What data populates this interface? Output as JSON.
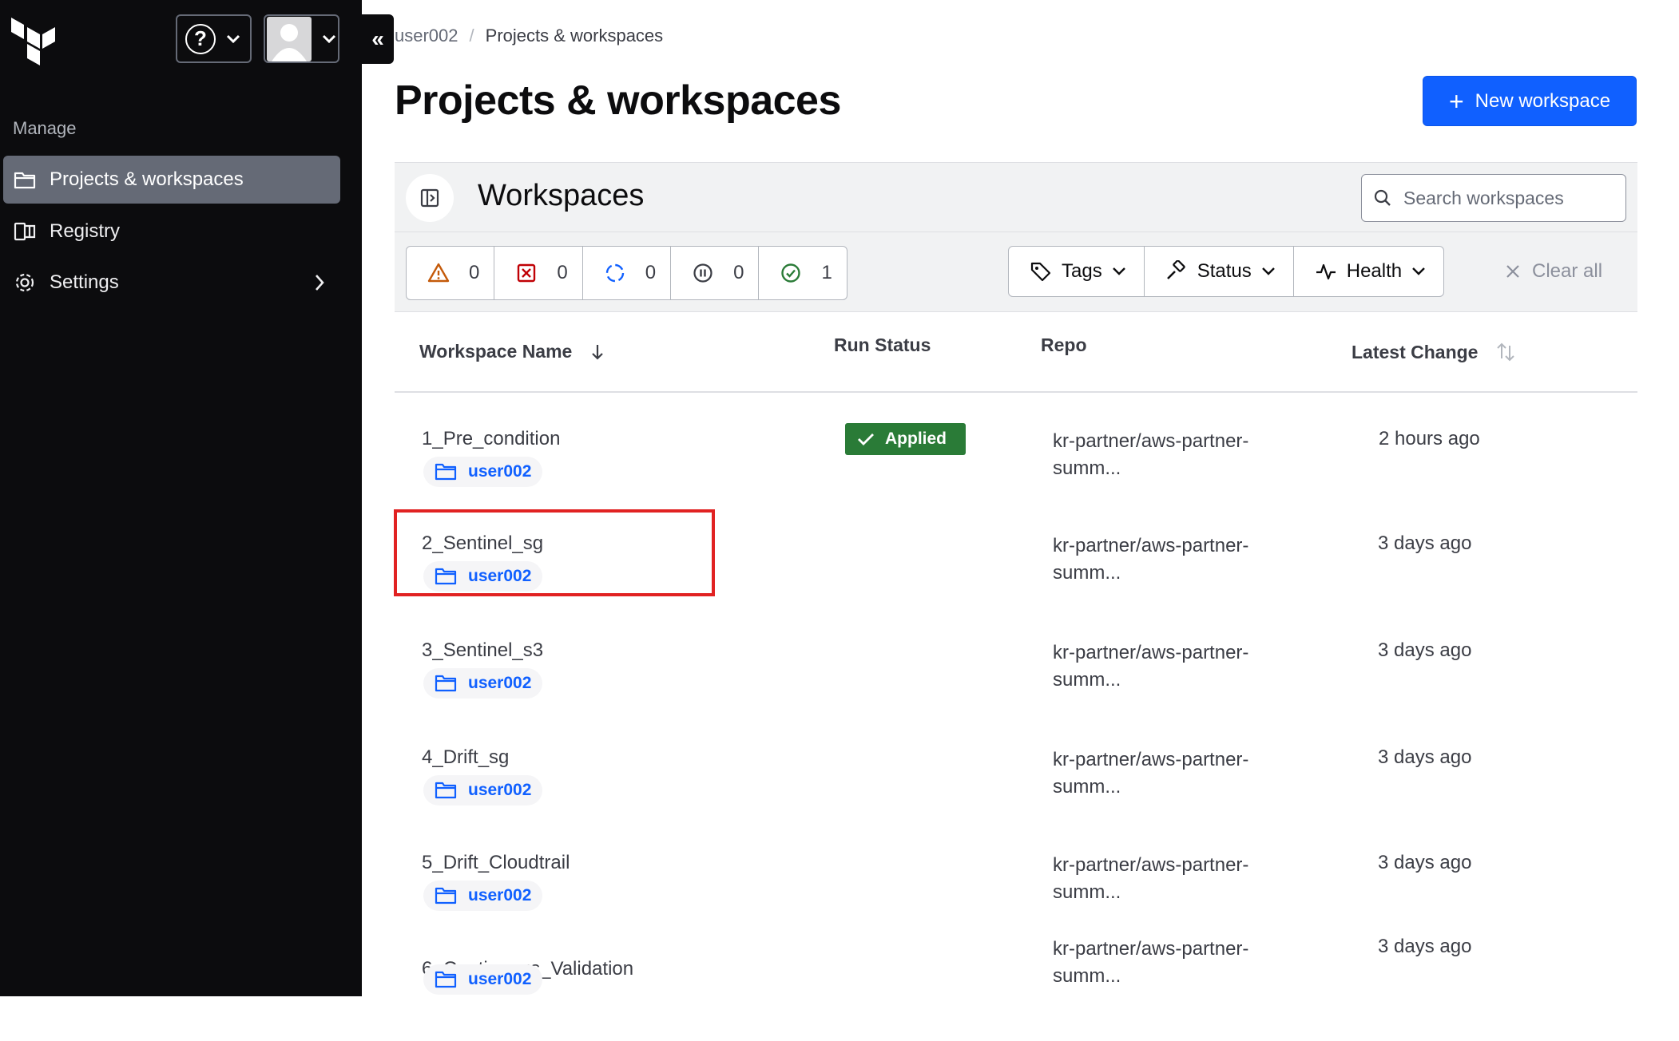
{
  "sidebar": {
    "section_label": "Manage",
    "items": [
      {
        "label": "Projects & workspaces",
        "icon": "folder-icon",
        "active": true
      },
      {
        "label": "Registry",
        "icon": "registry-icon",
        "active": false
      },
      {
        "label": "Settings",
        "icon": "gear-icon",
        "active": false
      }
    ],
    "collapse_glyph": "«",
    "help_glyph": "?"
  },
  "breadcrumb": {
    "parent": "user002",
    "separator": "/",
    "current": "Projects & workspaces"
  },
  "page": {
    "title": "Projects & workspaces",
    "new_workspace_label": "New workspace",
    "new_workspace_plus": "+"
  },
  "workspaces_panel": {
    "title": "Workspaces",
    "search_placeholder": "Search workspaces"
  },
  "status_counts": [
    {
      "icon": "warning-icon",
      "count": "0",
      "color": "#c45a0a"
    },
    {
      "icon": "error-icon",
      "count": "0",
      "color": "#c00005"
    },
    {
      "icon": "running-icon",
      "count": "0",
      "color": "#1060ff"
    },
    {
      "icon": "paused-icon",
      "count": "0",
      "color": "#3b3d45"
    },
    {
      "icon": "success-icon",
      "count": "1",
      "color": "#2a7b37"
    }
  ],
  "filters": {
    "tags": "Tags",
    "status": "Status",
    "health": "Health",
    "clear_all": "Clear all"
  },
  "table": {
    "columns": {
      "name": "Workspace Name",
      "run_status": "Run Status",
      "repo": "Repo",
      "latest_change": "Latest Change"
    },
    "rows": [
      {
        "name": "1_Pre_condition",
        "project": "user002",
        "run_status": "Applied",
        "repo_line1": "kr-partner/aws-partner-",
        "repo_line2": "summ...",
        "latest_change": "2 hours ago"
      },
      {
        "name": "2_Sentinel_sg",
        "project": "user002",
        "run_status": "",
        "repo_line1": "kr-partner/aws-partner-",
        "repo_line2": "summ...",
        "latest_change": "3 days ago"
      },
      {
        "name": "3_Sentinel_s3",
        "project": "user002",
        "run_status": "",
        "repo_line1": "kr-partner/aws-partner-",
        "repo_line2": "summ...",
        "latest_change": "3 days ago"
      },
      {
        "name": "4_Drift_sg",
        "project": "user002",
        "run_status": "",
        "repo_line1": "kr-partner/aws-partner-",
        "repo_line2": "summ...",
        "latest_change": "3 days ago"
      },
      {
        "name": "5_Drift_Cloudtrail",
        "project": "user002",
        "run_status": "",
        "repo_line1": "kr-partner/aws-partner-",
        "repo_line2": "summ...",
        "latest_change": "3 days ago"
      },
      {
        "name": "6_Continuous_Validation",
        "project": "user002",
        "run_status": "",
        "repo_line1": "kr-partner/aws-partner-",
        "repo_line2": "summ...",
        "latest_change": "3 days ago"
      }
    ]
  },
  "colors": {
    "sidebar_bg": "#0c0c0e",
    "primary": "#1060ff",
    "applied": "#2a7b37",
    "highlight": "#e12222"
  }
}
